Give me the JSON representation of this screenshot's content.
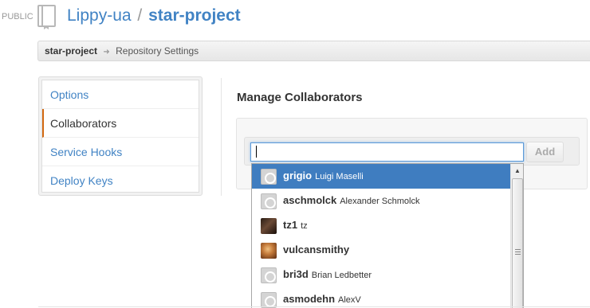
{
  "header": {
    "visibility": "PUBLIC",
    "owner": "Lippy-ua",
    "separator": "/",
    "repo": "star-project",
    "link_color": "#4183c4"
  },
  "breadcrumb": {
    "repo": "star-project",
    "arrow": "➜",
    "page": "Repository Settings"
  },
  "sidebar": {
    "items": [
      {
        "label": "Options",
        "selected": false
      },
      {
        "label": "Collaborators",
        "selected": true
      },
      {
        "label": "Service Hooks",
        "selected": false
      },
      {
        "label": "Deploy Keys",
        "selected": false
      }
    ],
    "selected_accent": "#d26911"
  },
  "main": {
    "title": "Manage Collaborators",
    "input_value": "",
    "add_label": "Add"
  },
  "dropdown": {
    "active_color": "#3f7dc0",
    "items": [
      {
        "login": "grigio",
        "name": "Luigi Maselli",
        "avatar": "octocat-icon",
        "active": true
      },
      {
        "login": "aschmolck",
        "name": "Alexander Schmolck",
        "avatar": "octocat-icon",
        "active": false
      },
      {
        "login": "tz1",
        "name": "tz",
        "avatar": "photo-avatar",
        "active": false
      },
      {
        "login": "vulcansmithy",
        "name": "",
        "avatar": "photo-avatar",
        "active": false
      },
      {
        "login": "bri3d",
        "name": "Brian Ledbetter",
        "avatar": "octocat-icon",
        "active": false
      },
      {
        "login": "asmodehn",
        "name": "AlexV",
        "avatar": "octocat-icon",
        "active": false
      }
    ]
  }
}
